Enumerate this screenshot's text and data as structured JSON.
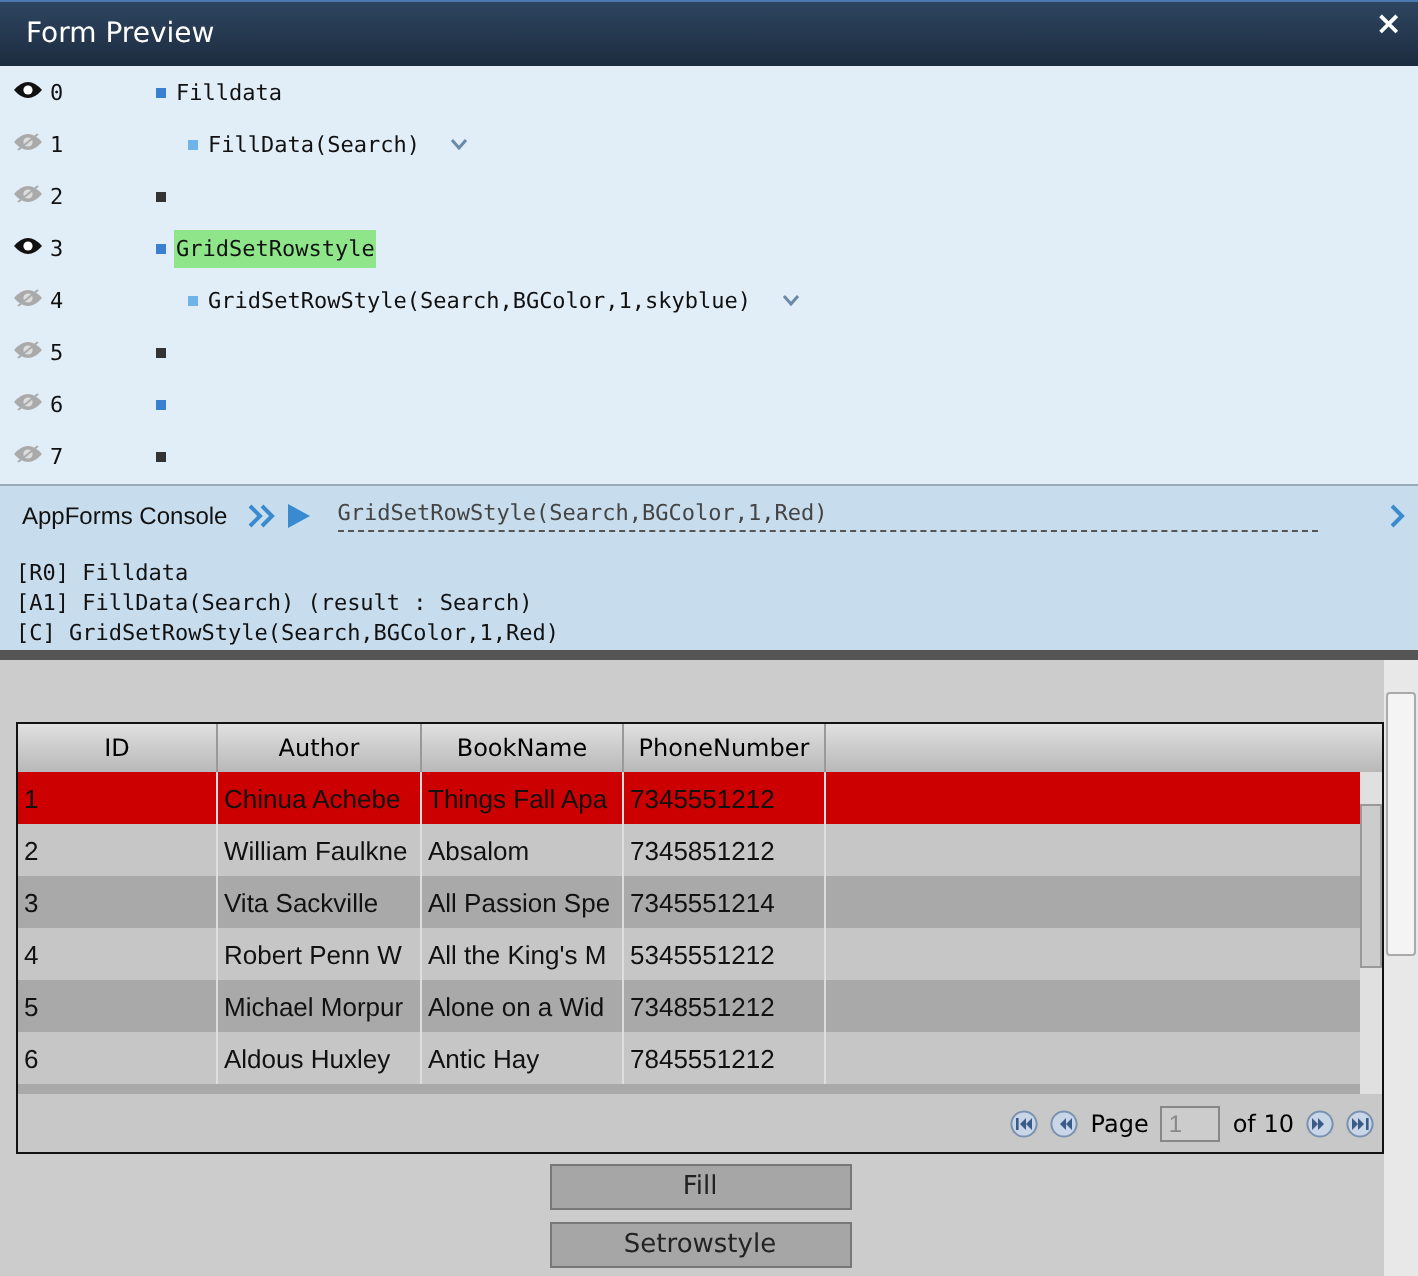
{
  "window": {
    "title": "Form Preview",
    "close": "×"
  },
  "code_lines": [
    {
      "number": "0",
      "visible": true,
      "color": "#3a7fd0",
      "text": "Filldata",
      "highlighted": false,
      "children": [
        {
          "number": "1",
          "visible": false,
          "color": "#6fb4e8",
          "text": "FillData(Search)",
          "dropdown": true
        }
      ]
    },
    {
      "number": "2",
      "visible": false,
      "color": "#333333"
    },
    {
      "number": "3",
      "visible": true,
      "color": "#3a7fd0",
      "text": "GridSetRowstyle",
      "highlighted": true,
      "children": [
        {
          "number": "4",
          "visible": false,
          "color": "#6fb4e8",
          "text": "GridSetRowStyle(Search,BGColor,1,skyblue)",
          "dropdown": true
        }
      ]
    },
    {
      "number": "5",
      "visible": false,
      "color": "#333333"
    },
    {
      "number": "6",
      "visible": false,
      "color": "#3a7fd0"
    },
    {
      "number": "7",
      "visible": false,
      "color": "#333333"
    }
  ],
  "console": {
    "title": "AppForms Console",
    "command": "GridSetRowStyle(Search,BGColor,1,Red)",
    "output": [
      "[R0] Filldata",
      "[A1] FillData(Search) (result : Search)",
      "[C] GridSetRowStyle(Search,BGColor,1,Red)"
    ]
  },
  "grid": {
    "columns": [
      "ID",
      "Author",
      "BookName",
      "PhoneNumber"
    ],
    "rows": [
      {
        "selected": true,
        "cells": [
          "1",
          "Chinua Achebe",
          "Things Fall Apa",
          "7345551212"
        ]
      },
      {
        "selected": false,
        "cells": [
          "2",
          "William Faulkne",
          "Absalom",
          "7345851212"
        ]
      },
      {
        "selected": false,
        "cells": [
          "3",
          "Vita Sackville",
          "All Passion Spe",
          "7345551214"
        ]
      },
      {
        "selected": false,
        "cells": [
          "4",
          "Robert Penn W",
          "All the King's M",
          "5345551212"
        ]
      },
      {
        "selected": false,
        "cells": [
          "5",
          "Michael Morpur",
          "Alone on a Wid",
          "7348551212"
        ]
      },
      {
        "selected": false,
        "cells": [
          "6",
          "Aldous Huxley",
          "Antic Hay",
          "7845551212"
        ]
      }
    ],
    "pager": {
      "label": "Page",
      "page": "1",
      "of": "of 10"
    }
  },
  "buttons": [
    "Fill",
    "Setrowstyle"
  ]
}
